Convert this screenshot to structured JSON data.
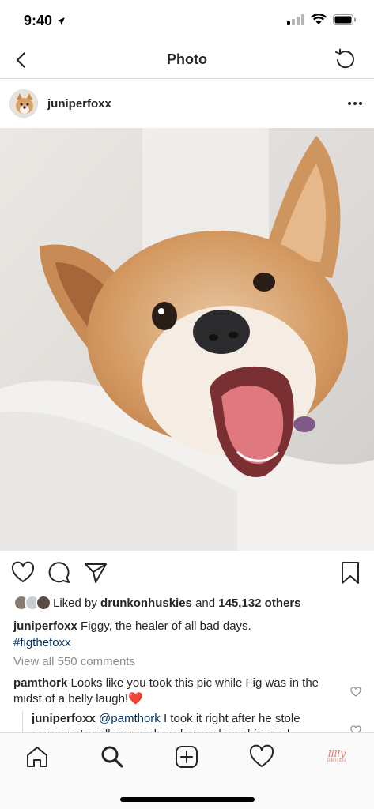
{
  "status_bar": {
    "time": "9:40"
  },
  "nav": {
    "title": "Photo"
  },
  "post": {
    "username": "juniperfoxx",
    "likes": {
      "prefix": "Liked by",
      "user": "drunkonhuskies",
      "middle": "and",
      "count": "145,132 others"
    },
    "caption": {
      "username": "juniperfoxx",
      "text": "Figgy, the healer of all bad days.",
      "hashtag": "#figthefoxx"
    },
    "view_comments": "View all 550 comments",
    "comment": {
      "username": "pamthork",
      "text": "Looks like you took this pic while Fig was in the midst of a belly laugh!",
      "emoji": "❤️"
    },
    "reply": {
      "username": "juniperfoxx",
      "mention": "@pamthork",
      "text": "I took it right after he stole someone's pullover and made me chase him and"
    }
  },
  "tabs": {
    "profile_logo_main": "lilly",
    "profile_logo_sub": "BRUSH"
  },
  "colors": {
    "link": "#003569",
    "muted": "#8e8e8e",
    "border": "#dbdbdb",
    "heart": "#d3212c",
    "profile_logo": "#e2766b"
  },
  "icons": [
    "location-arrow-icon",
    "signal-icon",
    "wifi-icon",
    "battery-icon",
    "back-chevron-icon",
    "refresh-icon",
    "more-icon",
    "heart-icon",
    "comment-icon",
    "share-icon",
    "bookmark-icon",
    "home-icon",
    "search-icon",
    "add-icon",
    "activity-heart-icon"
  ]
}
